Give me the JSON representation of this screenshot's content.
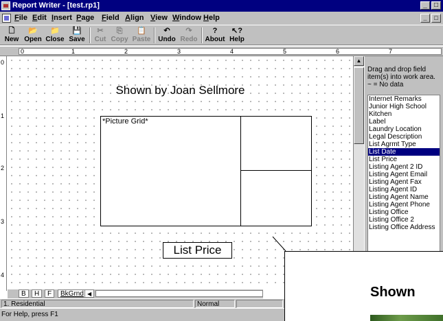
{
  "window": {
    "title": "Report Writer - [test.rp1]",
    "controls": [
      "_",
      "□"
    ]
  },
  "menu": {
    "items": [
      "File",
      "Edit",
      "Insert",
      "Page",
      "Field",
      "Align",
      "View",
      "Window",
      "Help"
    ],
    "mdi_controls": [
      "_",
      "□"
    ]
  },
  "toolbar": {
    "buttons": [
      {
        "label": "New",
        "icon": "🗋",
        "enabled": true
      },
      {
        "label": "Open",
        "icon": "📂",
        "enabled": true
      },
      {
        "label": "Close",
        "icon": "📁",
        "enabled": true
      },
      {
        "label": "Save",
        "icon": "💾",
        "enabled": true
      },
      {
        "label": "Cut",
        "icon": "✂",
        "enabled": false
      },
      {
        "label": "Copy",
        "icon": "⎘",
        "enabled": false
      },
      {
        "label": "Paste",
        "icon": "📋",
        "enabled": false
      },
      {
        "label": "Undo",
        "icon": "↶",
        "enabled": true
      },
      {
        "label": "Redo",
        "icon": "↷",
        "enabled": false
      },
      {
        "label": "About",
        "icon": "?",
        "enabled": true
      },
      {
        "label": "Help",
        "icon": "↖?",
        "enabled": true
      }
    ]
  },
  "ruler": {
    "horizontal_numbers": [
      "0",
      "1",
      "2",
      "3",
      "4",
      "5",
      "6",
      "7"
    ],
    "vertical_numbers": [
      "0",
      "1",
      "2",
      "3",
      "4"
    ]
  },
  "report": {
    "title": "Shown by Joan Sellmore",
    "picture_grid_label": "*Picture Grid*",
    "list_price_label": "List Price"
  },
  "field_panel": {
    "hint": "Drag and drop field item(s) into work area.",
    "no_data_note": "~ = No data",
    "items": [
      "Internet Remarks",
      "Junior High School",
      "Kitchen",
      "Label",
      "Laundry Location",
      "Legal Description",
      "List Agrmt Type",
      "List Date",
      "List Price",
      "Listing Agent 2 ID",
      "Listing Agent Email",
      "Listing Agent Fax",
      "Listing Agent ID",
      "Listing Agent Name",
      "Listing Agent Phone",
      "Listing Office",
      "Listing Office 2",
      "Listing Office Address"
    ],
    "selected": "List Date"
  },
  "tabs": {
    "items": [
      "B",
      "H",
      "F",
      "BkGrnd"
    ],
    "active": "BkGrnd"
  },
  "status": {
    "pane1": "1. Residential",
    "pane2": "Normal",
    "help": "For Help, press F1"
  },
  "zoom_callout": {
    "title": "Shown"
  }
}
